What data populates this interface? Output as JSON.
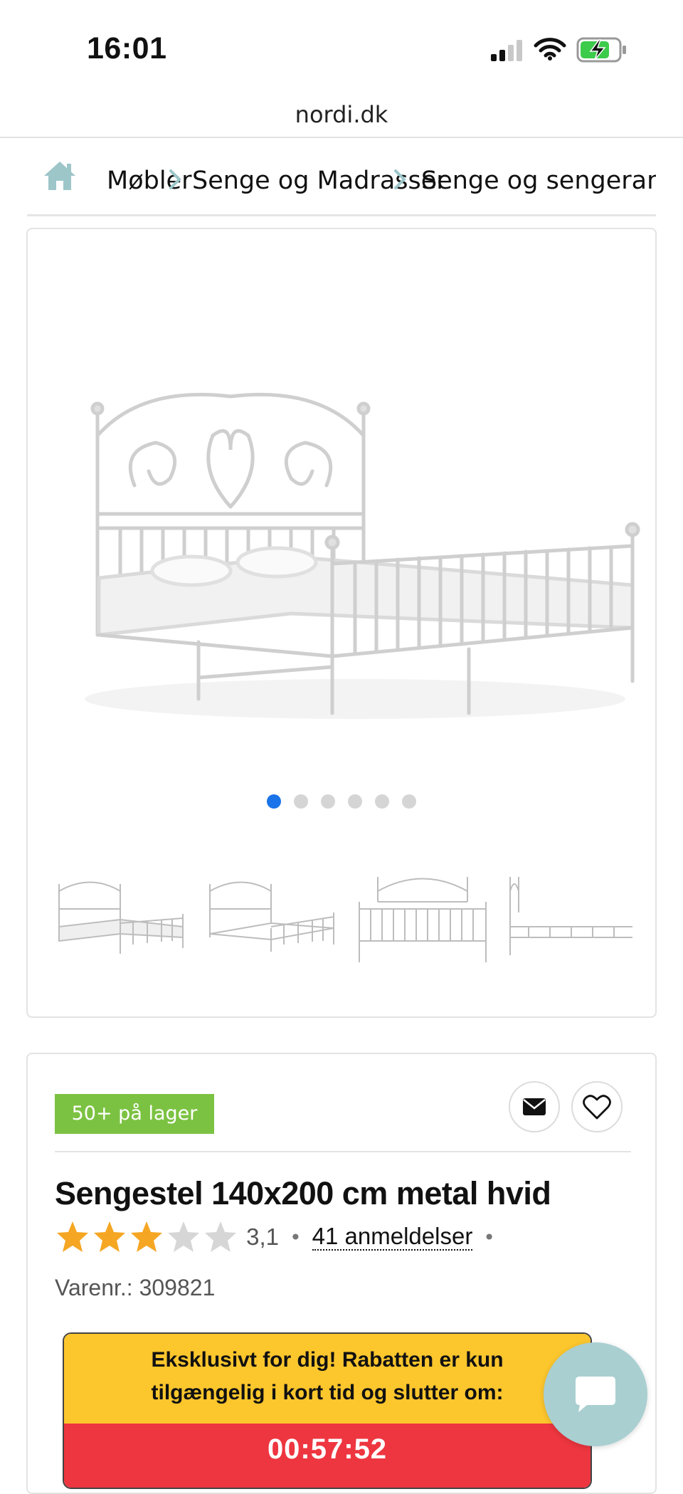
{
  "status_bar": {
    "time": "16:01"
  },
  "browser": {
    "url": "nordi.dk"
  },
  "breadcrumb": {
    "items": [
      "Møbler",
      "Senge og Madrasser",
      "Senge og sengerammer"
    ]
  },
  "gallery": {
    "image_count": 6,
    "active_index": 0,
    "thumbnail_count": 4
  },
  "product": {
    "stock_label": "50+ på lager",
    "title": "Sengestel 140x200 cm metal hvid",
    "rating_value": "3,1",
    "rating_stars": 3,
    "rating_max": 5,
    "reviews_label": "41 anmeldelser",
    "sku_label": "Varenr.:",
    "sku_value": "309821"
  },
  "promo": {
    "line1": "Eksklusivt for dig! Rabatten er kun",
    "line2": "tilgængelig i kort tid og slutter om:",
    "timer": "00:57:52"
  },
  "colors": {
    "stock_green": "#7cc242",
    "promo_yellow": "#fcc62d",
    "promo_red": "#ee3640",
    "star_orange": "#f5a623",
    "active_dot": "#1a73e8",
    "chat_button": "#a9cfd1"
  },
  "icons": [
    "signal-icon",
    "wifi-icon",
    "battery-charging-icon",
    "home-icon",
    "chevron-right-icon",
    "envelope-icon",
    "heart-icon",
    "star-icon",
    "chat-bubble-icon"
  ]
}
